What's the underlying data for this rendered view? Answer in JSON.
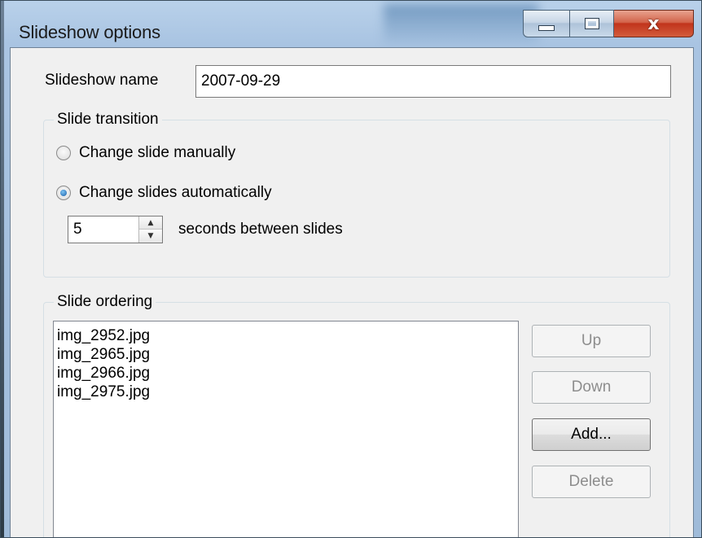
{
  "window": {
    "title": "Slideshow options",
    "caption_buttons": {
      "minimize_icon": "minimize-icon",
      "maximize_icon": "maximize-icon",
      "close_label": "x"
    }
  },
  "name_field": {
    "label": "Slideshow name",
    "value": "2007-09-29"
  },
  "transition": {
    "group_title": "Slide transition",
    "options": [
      {
        "label": "Change slide manually",
        "checked": false
      },
      {
        "label": "Change slides automatically",
        "checked": true
      }
    ],
    "seconds_value": "5",
    "seconds_label": "seconds between slides"
  },
  "ordering": {
    "group_title": "Slide ordering",
    "files": [
      "img_2952.jpg",
      "img_2965.jpg",
      "img_2966.jpg",
      "img_2975.jpg"
    ],
    "buttons": {
      "up": {
        "label": "Up",
        "enabled": false
      },
      "down": {
        "label": "Down",
        "enabled": false
      },
      "add": {
        "label": "Add...",
        "enabled": true
      },
      "delete": {
        "label": "Delete",
        "enabled": false
      }
    }
  },
  "colors": {
    "titlebar": "#a9c4e2",
    "client_bg": "#f0f0f0",
    "close_button": "#c1341c",
    "radio_selected": "#1a5fa8"
  }
}
